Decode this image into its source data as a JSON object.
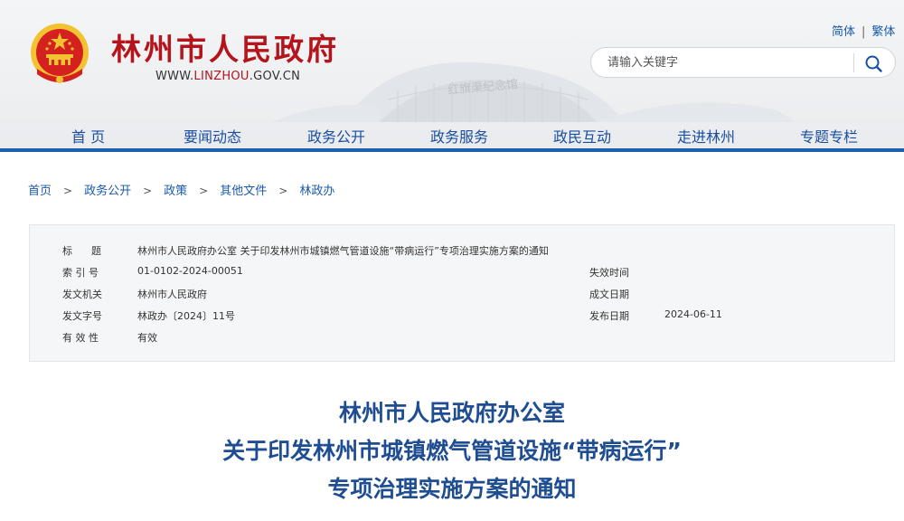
{
  "header": {
    "site_title": "林州市人民政府",
    "domain_prefix": "WWW.",
    "domain_highlight": "LINZHOU",
    "domain_suffix": ".GOV.CN",
    "lang_simplified": "简体",
    "lang_separator": "|",
    "lang_traditional": "繁体",
    "search_placeholder": "请输入关键字",
    "emblem_icon": "national-emblem-icon",
    "search_icon": "search-icon"
  },
  "nav": {
    "items": [
      {
        "label": "首  页"
      },
      {
        "label": "要闻动态"
      },
      {
        "label": "政务公开"
      },
      {
        "label": "政务服务"
      },
      {
        "label": "政民互动"
      },
      {
        "label": "走进林州"
      },
      {
        "label": "专题专栏"
      }
    ]
  },
  "breadcrumb": {
    "items": [
      "首页",
      "政务公开",
      "政策",
      "其他文件",
      "林政办"
    ],
    "separator": ">"
  },
  "info": {
    "title_key": "标      题",
    "title_value": "林州市人民政府办公室 关于印发林州市城镇燃气管道设施“带病运行”专项治理实施方案的通知",
    "index_key": "索 引 号",
    "index_value": "01-0102-2024-00051",
    "expiry_key": "失效时间",
    "expiry_value": "",
    "issuer_key": "发文机关",
    "issuer_value": "林州市人民政府",
    "written_key": "成文日期",
    "written_value": "",
    "docno_key": "发文字号",
    "docno_value": "林政办〔2024〕11号",
    "published_key": "发布日期",
    "published_value": "2024-06-11",
    "validity_key": "有 效 性",
    "validity_value": "有效"
  },
  "document": {
    "title_line1": "林州市人民政府办公室",
    "title_line2": "关于印发林州市城镇燃气管道设施“带病运行”",
    "title_line3": "专项治理实施方案的通知"
  },
  "colors": {
    "brand_red": "#b5141a",
    "nav_blue": "#1a4fa0",
    "title_blue": "#1f4d92",
    "emblem_gold": "#f2c230"
  }
}
